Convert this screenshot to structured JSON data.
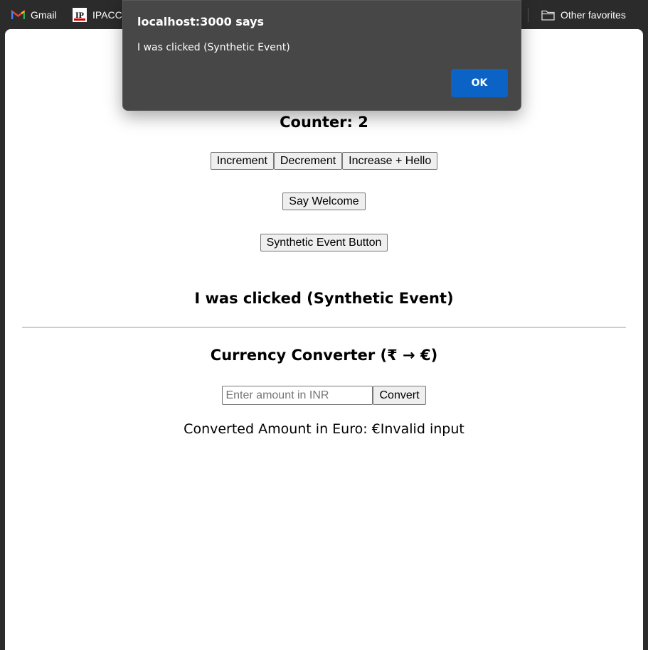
{
  "bookmarks": {
    "items": [
      {
        "label": "Gmail",
        "icon": "gmail-icon"
      },
      {
        "label": "IPACCT",
        "icon": "ip-logo-icon"
      },
      {
        "label": "Other favorites",
        "icon": "folder-icon"
      }
    ]
  },
  "dialog": {
    "title": "localhost:3000 says",
    "message": "I was clicked (Synthetic Event)",
    "ok_label": "OK",
    "ok_color": "#0a63c5"
  },
  "counter": {
    "text": "Counter: 2",
    "increment_label": "Increment",
    "decrement_label": "Decrement",
    "increase_hello_label": "Increase + Hello"
  },
  "welcome": {
    "button_label": "Say Welcome"
  },
  "synthetic": {
    "button_label": "Synthetic Event Button",
    "result_text": "I was clicked (Synthetic Event)"
  },
  "converter": {
    "title": "Currency Converter (₹ → €)",
    "input_value": "",
    "input_placeholder": "Enter amount in INR",
    "convert_label": "Convert",
    "result_text": "Converted Amount in Euro: €Invalid input"
  }
}
